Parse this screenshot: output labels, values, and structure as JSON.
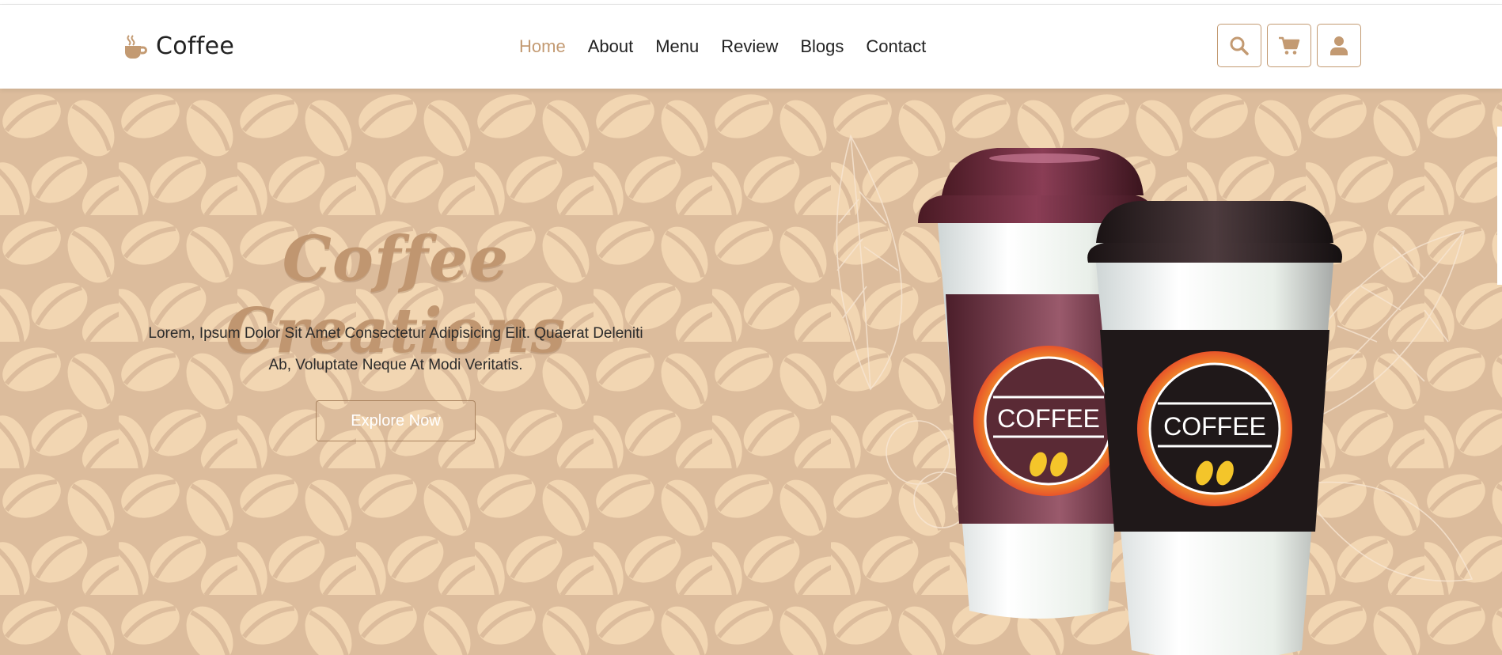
{
  "brand": {
    "name": "Coffee",
    "icon": "coffee-cup-icon"
  },
  "nav": {
    "items": [
      {
        "label": "Home",
        "active": true
      },
      {
        "label": "About",
        "active": false
      },
      {
        "label": "Menu",
        "active": false
      },
      {
        "label": "Review",
        "active": false
      },
      {
        "label": "Blogs",
        "active": false
      },
      {
        "label": "Contact",
        "active": false
      }
    ]
  },
  "header_icons": [
    "search-icon",
    "cart-icon",
    "user-icon"
  ],
  "hero": {
    "title": "Coffee Creations",
    "description_line1": "Lorem, Ipsum Dolor Sit Amet Consectetur Adipisicing Elit. Quaerat Deleniti",
    "description_line2": "Ab, Voluptate Neque At Modi Veritatis.",
    "button_label": "Explore Now",
    "cup_left_label": "COFFEE",
    "cup_right_label": "COFFEE"
  },
  "colors": {
    "accent": "#c39a72",
    "hero_bg": "#dcbc9c",
    "bean": "#f2d6b2",
    "cup_dark": "#5a2a35",
    "cup_black": "#1f1819"
  }
}
